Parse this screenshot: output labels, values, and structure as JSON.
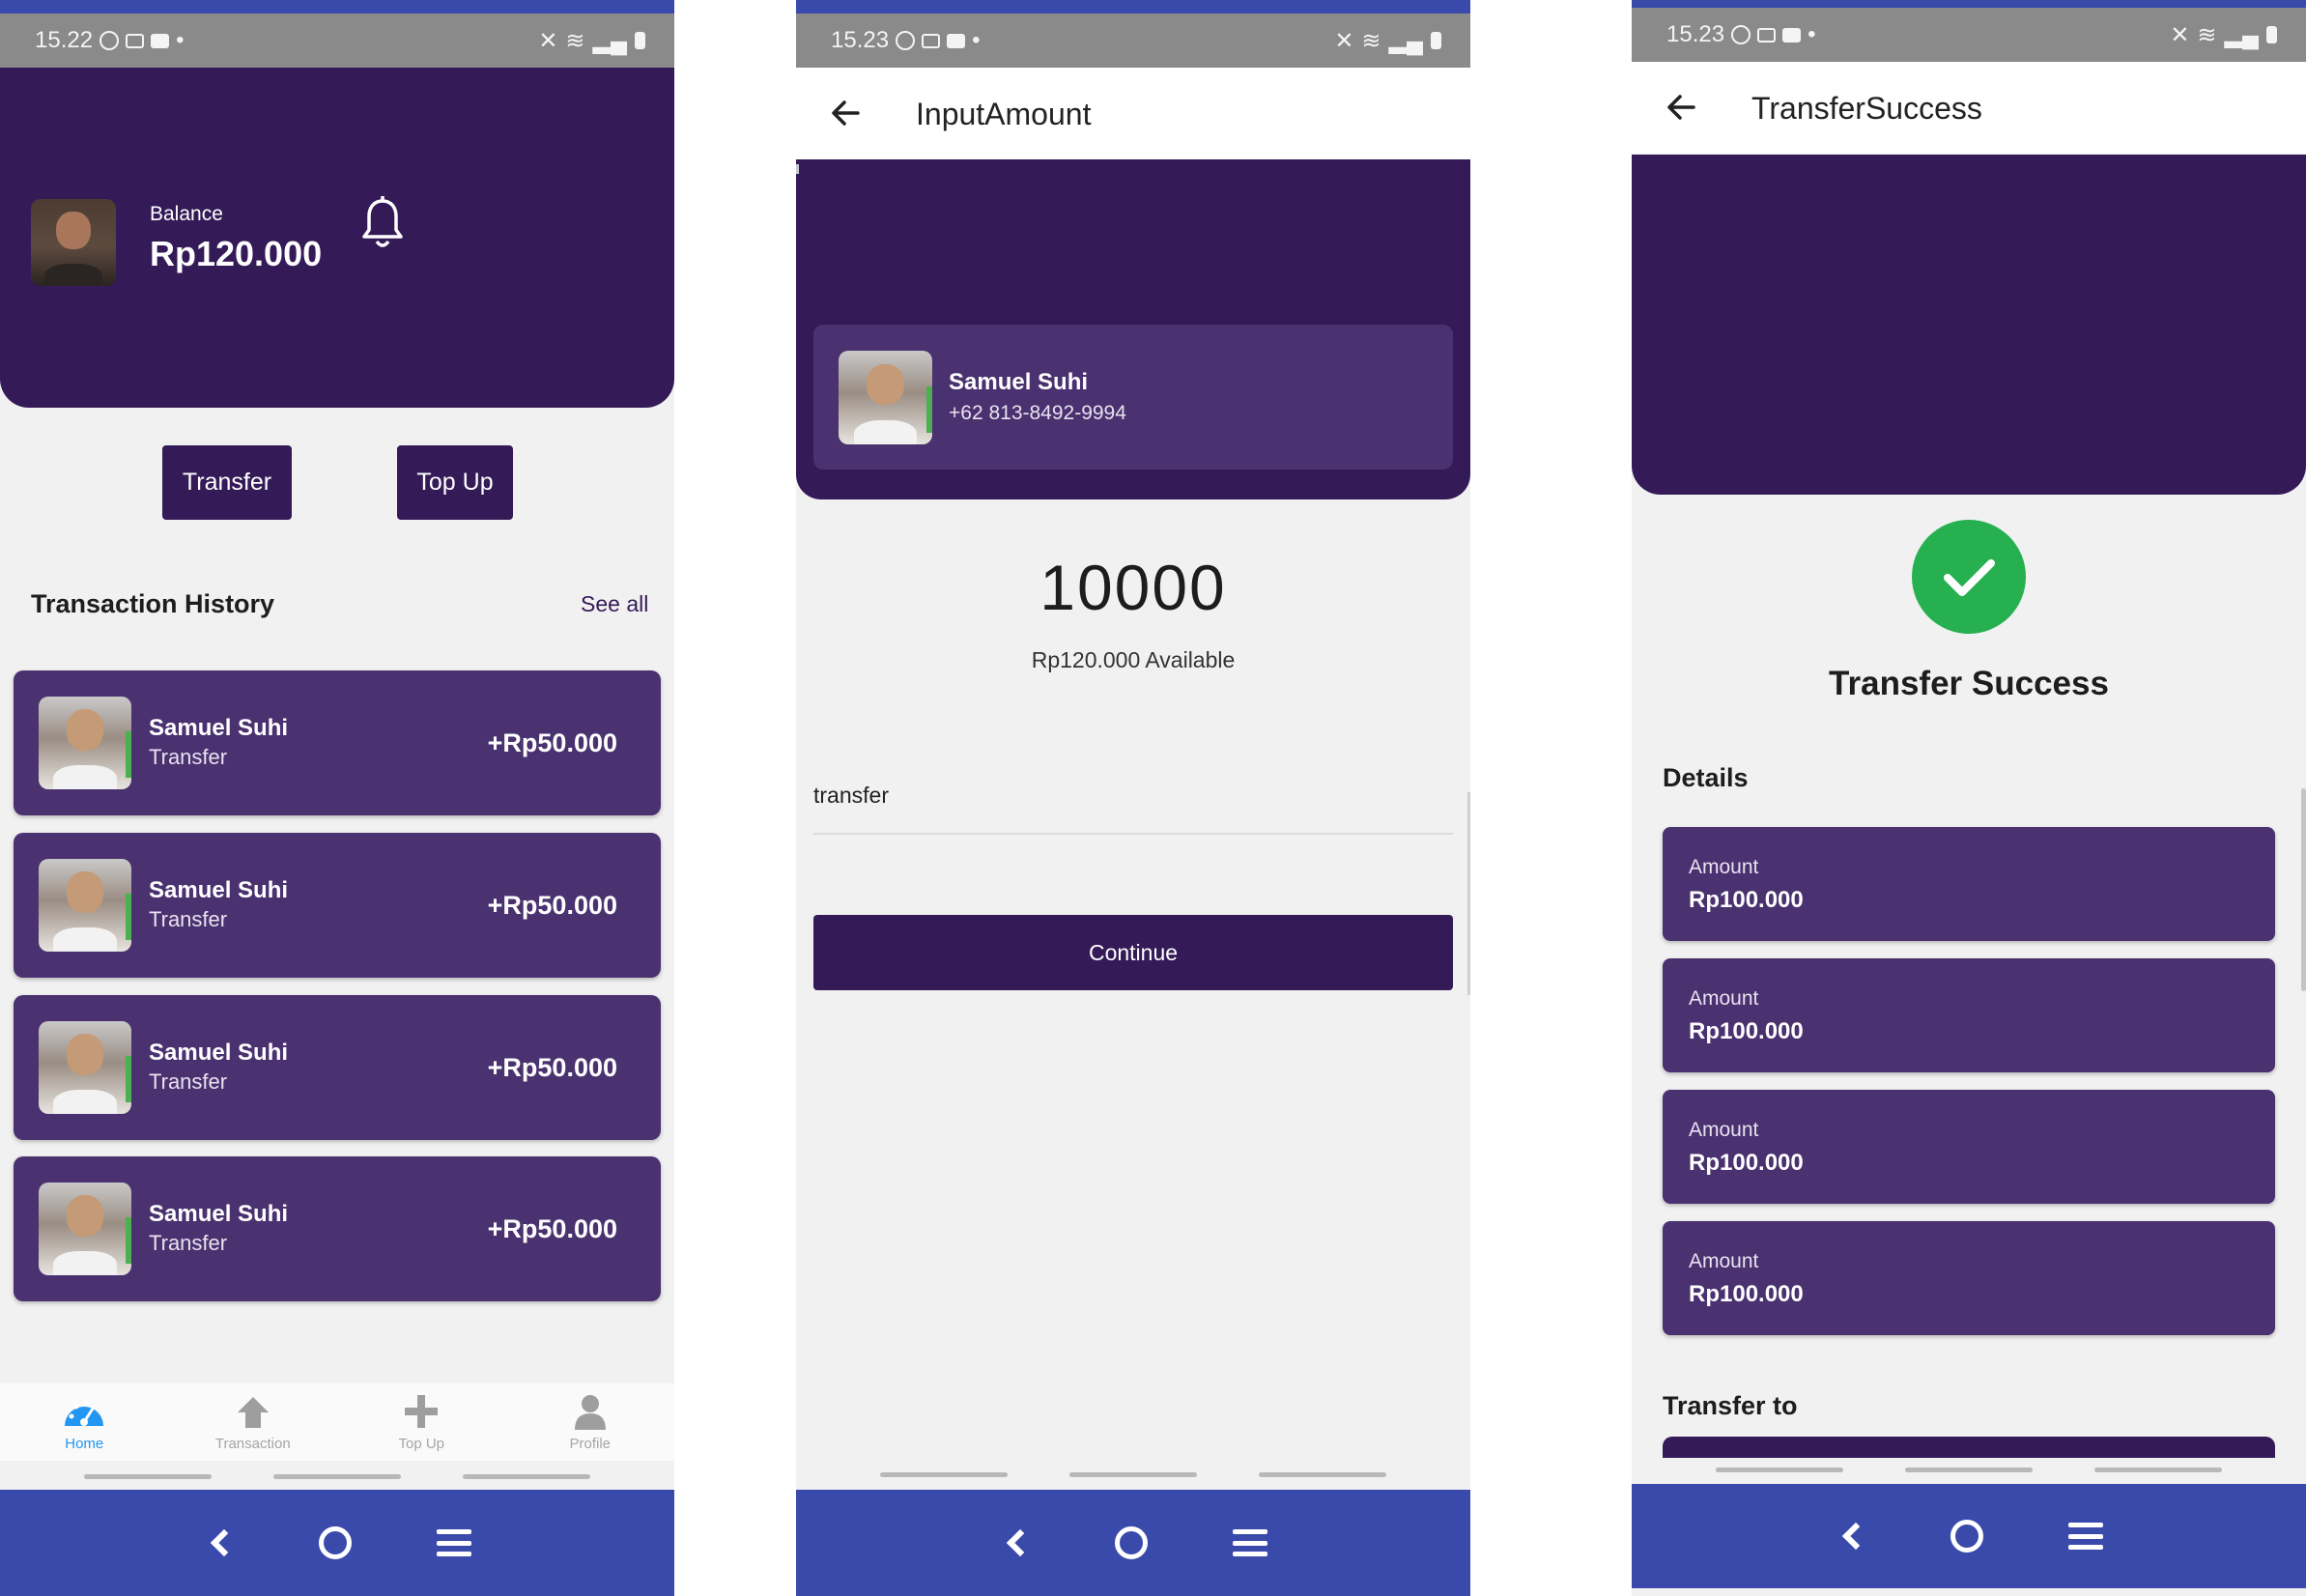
{
  "phone1": {
    "status_time": "15.22",
    "balance_label": "Balance",
    "balance_value": "Rp120.000",
    "buttons": {
      "transfer": "Transfer",
      "top_up": "Top Up"
    },
    "history_title": "Transaction History",
    "see_all": "See all",
    "transactions": [
      {
        "name": "Samuel Suhi",
        "type": "Transfer",
        "amount": "+Rp50.000"
      },
      {
        "name": "Samuel Suhi",
        "type": "Transfer",
        "amount": "+Rp50.000"
      },
      {
        "name": "Samuel Suhi",
        "type": "Transfer",
        "amount": "+Rp50.000"
      },
      {
        "name": "Samuel Suhi",
        "type": "Transfer",
        "amount": "+Rp50.000"
      }
    ],
    "bottom_nav": [
      {
        "label": "Home",
        "icon": "dashboard-icon",
        "active": true
      },
      {
        "label": "Transaction",
        "icon": "arrow-up-icon",
        "active": false
      },
      {
        "label": "Top Up",
        "icon": "plus-icon",
        "active": false
      },
      {
        "label": "Profile",
        "icon": "person-icon",
        "active": false
      }
    ]
  },
  "phone2": {
    "status_time": "15.23",
    "title": "InputAmount",
    "contact": {
      "name": "Samuel Suhi",
      "phone": "+62 813-8492-9994"
    },
    "amount": "10000",
    "available": "Rp120.000 Available",
    "note_value": "transfer",
    "continue_label": "Continue"
  },
  "phone3": {
    "status_time": "15.23",
    "title": "TransferSuccess",
    "success_title": "Transfer Success",
    "details_heading": "Details",
    "details": [
      {
        "label": "Amount",
        "value": "Rp100.000"
      },
      {
        "label": "Amount",
        "value": "Rp100.000"
      },
      {
        "label": "Amount",
        "value": "Rp100.000"
      },
      {
        "label": "Amount",
        "value": "Rp100.000"
      }
    ],
    "transfer_to_heading": "Transfer to"
  },
  "colors": {
    "primary": "#341a57",
    "card": "#4a316f",
    "system_bar": "#3a4aab",
    "status_bar": "#8a8a8a",
    "success": "#26b04f",
    "nav_active": "#2196f3"
  }
}
